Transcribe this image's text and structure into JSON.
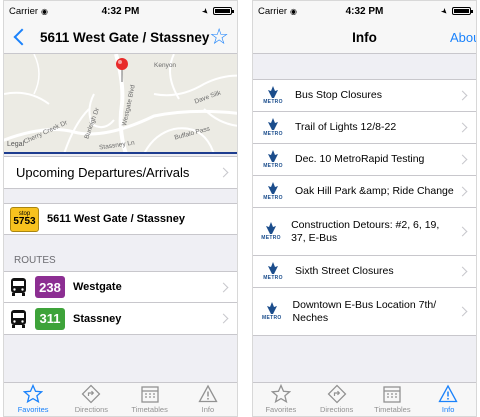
{
  "status_bar": {
    "carrier": "Carrier",
    "time": "4:32 PM"
  },
  "left_screen": {
    "nav_title": "5611 West Gate / Stassney",
    "map": {
      "legal": "Legal",
      "street_labels": [
        "Westgate Blvd",
        "Cherry Creek Dr",
        "Buffalo Pass",
        "Burleigh Dr",
        "Kenyon",
        "Dave Silk",
        "Stassney Ln"
      ]
    },
    "departures_label": "Upcoming Departures/Arrivals",
    "stop": {
      "badge_word": "stop",
      "number": "5753",
      "name": "5611 West Gate / Stassney"
    },
    "routes_header": "ROUTES",
    "routes": [
      {
        "number": "238",
        "name": "Westgate",
        "color": "#8c2e92"
      },
      {
        "number": "311",
        "name": "Stassney",
        "color": "#3ea33a"
      }
    ]
  },
  "right_screen": {
    "nav_title": "Info",
    "nav_right": "About",
    "logo_word": "METRO",
    "items": [
      {
        "text": "Bus Stop Closures"
      },
      {
        "text": "Trail of Lights 12/8-22"
      },
      {
        "text": "Dec. 10 MetroRapid Testing"
      },
      {
        "text": "Oak Hill Park &amp; Ride Change"
      },
      {
        "text": "Construction Detours: #2, 6, 19, 37, E-Bus"
      },
      {
        "text": "Sixth Street Closures"
      },
      {
        "text": "Downtown E-Bus Location 7th/ Neches"
      }
    ]
  },
  "tabs": [
    "Favorites",
    "Directions",
    "Timetables",
    "Info"
  ],
  "tab_icons": [
    "star-icon",
    "directions-icon",
    "calendar-icon",
    "warning-icon"
  ],
  "colors": {
    "accent": "#1a82fb",
    "stop_badge": "#f7c21e",
    "metro_blue": "#1b4d8c"
  }
}
